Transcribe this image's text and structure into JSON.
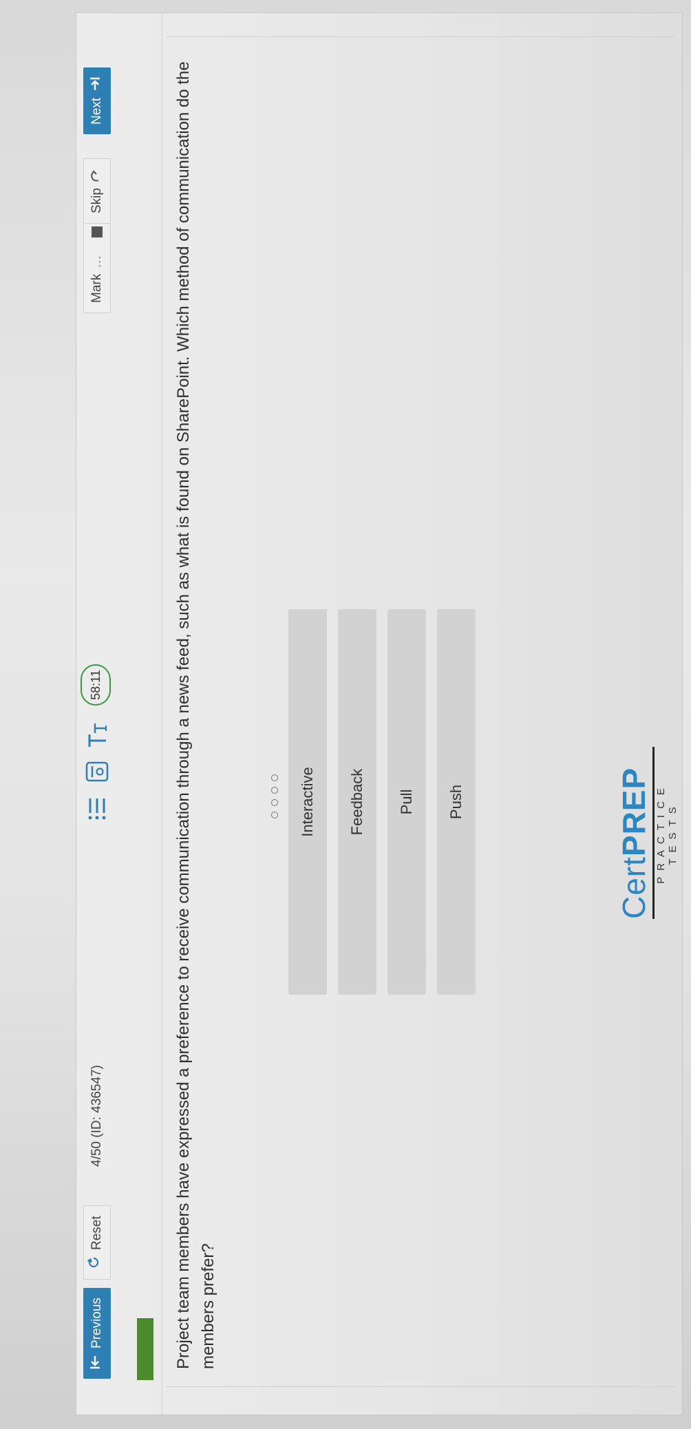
{
  "toolbar": {
    "previous_label": "Previous",
    "reset_label": "Reset",
    "question_counter": "4/50 (ID: 436547)",
    "timer": "58:11",
    "mark_label": "Mark",
    "skip_label": "Skip",
    "next_label": "Next",
    "icons": [
      "list-icon",
      "calculator-icon",
      "text-size-icon"
    ]
  },
  "question": {
    "text": "Project team members have expressed a preference to receive communication through a news feed, such as what is found on SharePoint. Which method of communication do the members prefer?"
  },
  "options": [
    {
      "label": "Interactive"
    },
    {
      "label": "Feedback"
    },
    {
      "label": "Pull"
    },
    {
      "label": "Push"
    }
  ],
  "logo": {
    "cert": "Cert",
    "prep": "PREP",
    "tagline": "PRACTICE TESTS"
  },
  "colors": {
    "primary_button": "#2e7fb4",
    "progress": "#4b8a2d",
    "timer_ring": "#3a9a3f",
    "logo": "#2e86c1"
  }
}
